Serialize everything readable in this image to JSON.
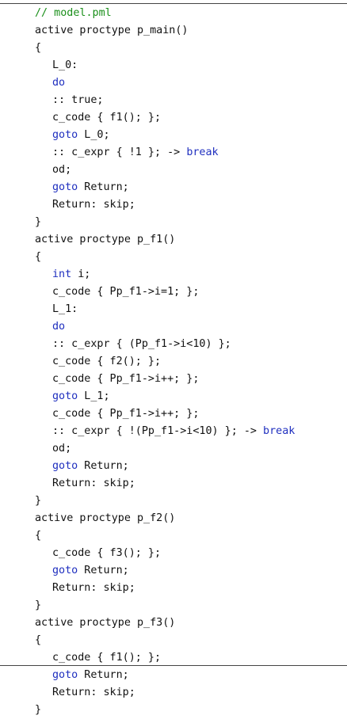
{
  "document": {
    "lines": [
      {
        "indent": 0,
        "parts": [
          {
            "t": "// model.pml",
            "c": "comment"
          }
        ]
      },
      {
        "indent": 0,
        "parts": [
          {
            "t": "active proctype p_main()"
          }
        ]
      },
      {
        "indent": 0,
        "parts": [
          {
            "t": "{"
          }
        ]
      },
      {
        "indent": 1,
        "parts": [
          {
            "t": "L_0:"
          }
        ]
      },
      {
        "indent": 1,
        "parts": [
          {
            "t": "do",
            "c": "kw"
          }
        ]
      },
      {
        "indent": 1,
        "parts": [
          {
            "t": ":: true;"
          }
        ]
      },
      {
        "indent": 1,
        "parts": [
          {
            "t": "c_code { f1(); };"
          }
        ]
      },
      {
        "indent": 1,
        "parts": [
          {
            "t": "goto",
            "c": "kw"
          },
          {
            "t": " L_0;"
          }
        ]
      },
      {
        "indent": 1,
        "parts": [
          {
            "t": ":: c_expr { !1 }; -> "
          },
          {
            "t": "break",
            "c": "kw"
          }
        ]
      },
      {
        "indent": 1,
        "parts": [
          {
            "t": "od;"
          }
        ]
      },
      {
        "indent": 1,
        "parts": [
          {
            "t": "goto",
            "c": "kw"
          },
          {
            "t": " Return;"
          }
        ]
      },
      {
        "indent": 1,
        "parts": [
          {
            "t": "Return: skip;"
          }
        ]
      },
      {
        "indent": 0,
        "parts": [
          {
            "t": "}"
          }
        ]
      },
      {
        "indent": 0,
        "parts": [
          {
            "t": "active proctype p_f1()"
          }
        ]
      },
      {
        "indent": 0,
        "parts": [
          {
            "t": "{"
          }
        ]
      },
      {
        "indent": 1,
        "parts": [
          {
            "t": "int",
            "c": "kw"
          },
          {
            "t": " i;"
          }
        ]
      },
      {
        "indent": 1,
        "parts": [
          {
            "t": "c_code { Pp_f1->i=1; };"
          }
        ]
      },
      {
        "indent": 1,
        "parts": [
          {
            "t": "L_1:"
          }
        ]
      },
      {
        "indent": 1,
        "parts": [
          {
            "t": "do",
            "c": "kw"
          }
        ]
      },
      {
        "indent": 1,
        "parts": [
          {
            "t": ":: c_expr { (Pp_f1->i<10) };"
          }
        ]
      },
      {
        "indent": 1,
        "parts": [
          {
            "t": "c_code { f2(); };"
          }
        ]
      },
      {
        "indent": 1,
        "parts": [
          {
            "t": "c_code { Pp_f1->i++; };"
          }
        ]
      },
      {
        "indent": 1,
        "parts": [
          {
            "t": "goto",
            "c": "kw"
          },
          {
            "t": " L_1;"
          }
        ]
      },
      {
        "indent": 1,
        "parts": [
          {
            "t": "c_code { Pp_f1->i++; };"
          }
        ]
      },
      {
        "indent": 1,
        "parts": [
          {
            "t": ":: c_expr { !(Pp_f1->i<10) }; -> "
          },
          {
            "t": "break",
            "c": "kw"
          }
        ]
      },
      {
        "indent": 1,
        "parts": [
          {
            "t": "od;"
          }
        ]
      },
      {
        "indent": 1,
        "parts": [
          {
            "t": "goto",
            "c": "kw"
          },
          {
            "t": " Return;"
          }
        ]
      },
      {
        "indent": 1,
        "parts": [
          {
            "t": "Return: skip;"
          }
        ]
      },
      {
        "indent": 0,
        "parts": [
          {
            "t": "}"
          }
        ]
      },
      {
        "indent": 0,
        "parts": [
          {
            "t": "active proctype p_f2()"
          }
        ]
      },
      {
        "indent": 0,
        "parts": [
          {
            "t": "{"
          }
        ]
      },
      {
        "indent": 1,
        "parts": [
          {
            "t": "c_code { f3(); };"
          }
        ]
      },
      {
        "indent": 1,
        "parts": [
          {
            "t": "goto",
            "c": "kw"
          },
          {
            "t": " Return;"
          }
        ]
      },
      {
        "indent": 1,
        "parts": [
          {
            "t": "Return: skip;"
          }
        ]
      },
      {
        "indent": 0,
        "parts": [
          {
            "t": "}"
          }
        ]
      },
      {
        "indent": 0,
        "parts": [
          {
            "t": "active proctype p_f3()"
          }
        ]
      },
      {
        "indent": 0,
        "parts": [
          {
            "t": "{"
          }
        ]
      },
      {
        "indent": 1,
        "parts": [
          {
            "t": "c_code { f1(); };"
          }
        ]
      },
      {
        "indent": 1,
        "parts": [
          {
            "t": "goto",
            "c": "kw"
          },
          {
            "t": " Return;"
          }
        ]
      },
      {
        "indent": 1,
        "parts": [
          {
            "t": "Return: skip;"
          }
        ]
      },
      {
        "indent": 0,
        "parts": [
          {
            "t": "}"
          }
        ]
      }
    ]
  }
}
